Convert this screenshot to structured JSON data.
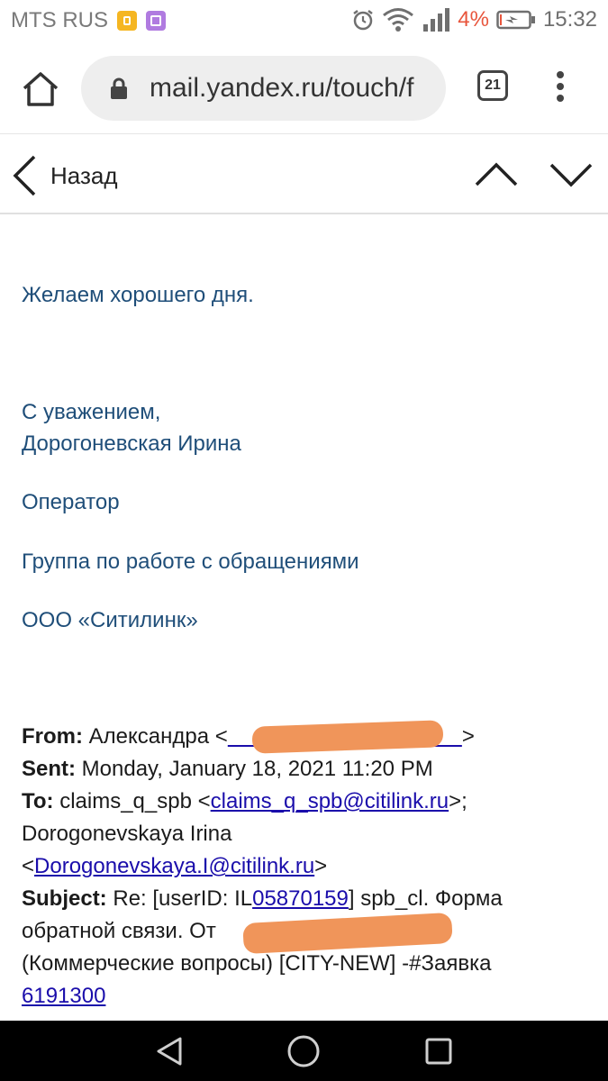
{
  "status_bar": {
    "carrier": "MTS RUS",
    "battery_percent": "4%",
    "time": "15:32",
    "icons": [
      "sim-badge-icon",
      "gallery-badge-icon",
      "alarm-icon",
      "wifi-icon",
      "signal-icon",
      "battery-icon"
    ],
    "battery_color": "#e8553c"
  },
  "browser": {
    "url": "mail.yandex.ru/touch/f",
    "tab_count": "21"
  },
  "toolbar": {
    "back_label": "Назад"
  },
  "email": {
    "greeting": "Желаем хорошего дня.",
    "signoff": "С уважением,",
    "sender_name": "Дорогоневская Ирина",
    "role": "Оператор",
    "group": "Группа по работе с обращениями",
    "company": "ООО «Ситилинк»",
    "quoted": {
      "from_label": "From:",
      "from_name": "Александра <",
      "from_close": ">",
      "sent_label": "Sent:",
      "sent_value": "Monday, January 18, 2021 11:20 PM",
      "to_label": "To:",
      "to_name": "claims_q_spb <",
      "to_email": "claims_q_spb@citilink.ru",
      "to_after": ">;",
      "cc_name": "Dorogonevskaya Irina",
      "cc_open": "<",
      "cc_email": "Dorogonevskaya.I@citilink.ru",
      "cc_close": ">",
      "subject_label": "Subject:",
      "subject_part1": "Re: [userID: IL",
      "subject_userid": "05870159",
      "subject_part2": "] spb_cl. Форма обратной связи. От",
      "subject_part3": "(Коммерческие вопросы) [CITY-NEW] -#Заявка",
      "ticket_number": "6191300"
    }
  },
  "colors": {
    "body_text_blue": "#1f4e79",
    "link": "#1a0dab",
    "redaction": "#f0955a"
  }
}
